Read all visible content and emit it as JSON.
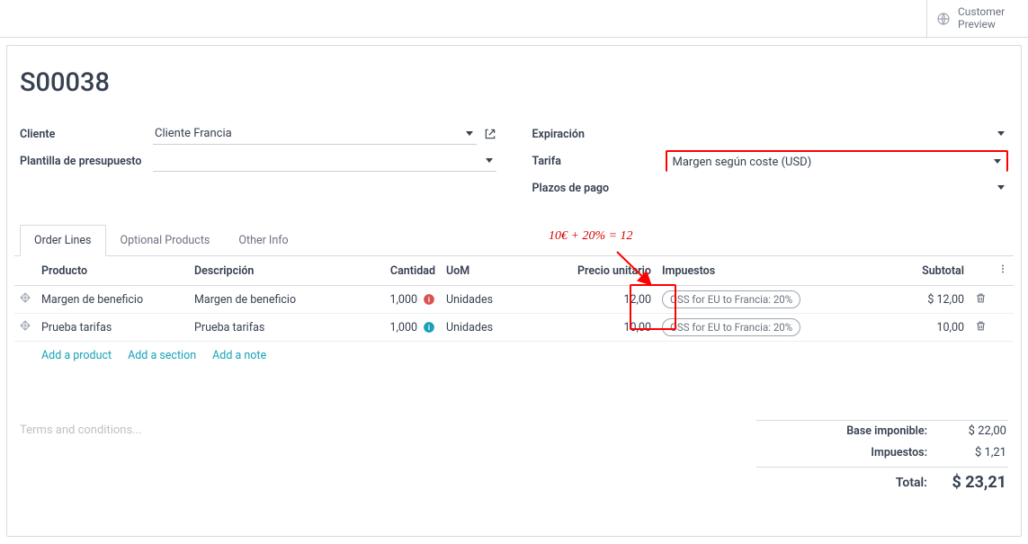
{
  "topbar": {
    "preview_line1": "Customer",
    "preview_line2": "Preview"
  },
  "doc_title": "S00038",
  "form": {
    "left": {
      "cliente_label": "Cliente",
      "cliente_value": "Cliente Francia",
      "plantilla_label": "Plantilla de presupuesto",
      "plantilla_value": ""
    },
    "right": {
      "expiracion_label": "Expiración",
      "expiracion_value": "",
      "tarifa_label": "Tarifa",
      "tarifa_value": "Margen según coste (USD)",
      "plazos_label": "Plazos de pago",
      "plazos_value": ""
    }
  },
  "annotation_formula": "10€ + 20% = 12",
  "tabs": {
    "order_lines": "Order Lines",
    "optional_products": "Optional Products",
    "other_info": "Other Info"
  },
  "table": {
    "headers": {
      "producto": "Producto",
      "descripcion": "Descripción",
      "cantidad": "Cantidad",
      "uom": "UoM",
      "precio": "Precio unitario",
      "impuestos": "Impuestos",
      "subtotal": "Subtotal"
    },
    "rows": [
      {
        "producto": "Margen de beneficio",
        "descripcion": "Margen de beneficio",
        "cantidad": "1,000",
        "info_color": "#d9534f",
        "uom": "Unidades",
        "precio": "12,00",
        "tax": "OSS for EU to Francia: 20%",
        "subtotal": "$ 12,00"
      },
      {
        "producto": "Prueba tarifas",
        "descripcion": "Prueba tarifas",
        "cantidad": "1,000",
        "info_color": "#17a2b8",
        "uom": "Unidades",
        "precio": "10,00",
        "tax": "OSS for EU to Francia: 20%",
        "subtotal": "10,00"
      }
    ],
    "add_product": "Add a product",
    "add_section": "Add a section",
    "add_note": "Add a note"
  },
  "terms_placeholder": "Terms and conditions...",
  "totals": {
    "base_label": "Base imponible:",
    "base_val": "$ 22,00",
    "imp_label": "Impuestos:",
    "imp_val": "$ 1,21",
    "total_label": "Total:",
    "total_val": "$ 23,21"
  }
}
